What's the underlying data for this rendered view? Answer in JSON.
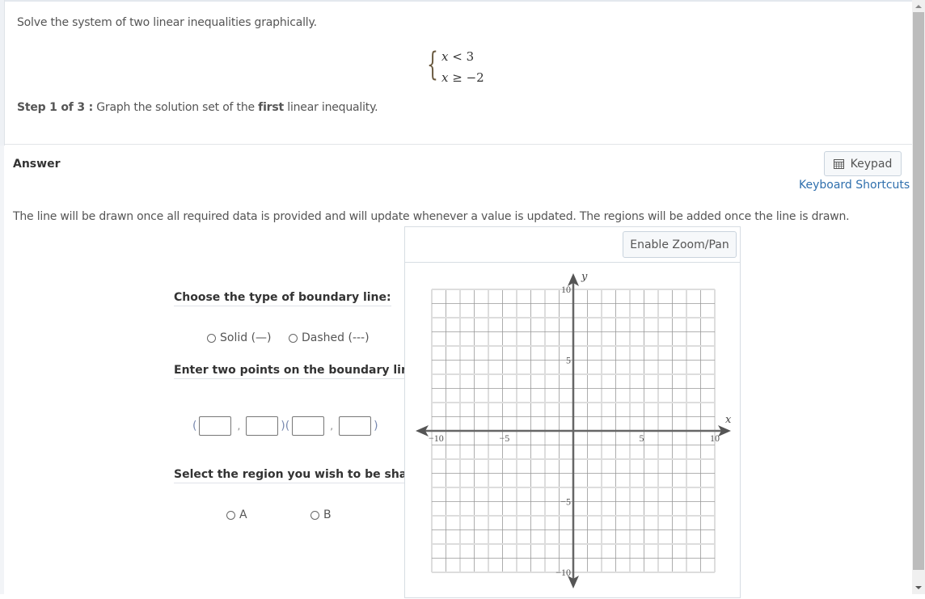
{
  "question": {
    "prompt": "Solve the system of two linear inequalities graphically.",
    "system": [
      {
        "var": "x",
        "op": "<",
        "rhs": "3"
      },
      {
        "var": "x",
        "op": "≥",
        "rhs": "−2"
      }
    ],
    "step_prefix": "Step 1 of 3 :",
    "step_text_before": " Graph the solution set of the ",
    "step_bold": "first",
    "step_text_after": " linear inequality."
  },
  "answer": {
    "label": "Answer",
    "keypad_label": "Keypad",
    "keyboard_shortcuts_label": "Keyboard Shortcuts",
    "info": "The line will be drawn once all required data is provided and will update whenever a value is updated. The regions will be added once the line is drawn.",
    "boundary_label": "Choose the type of boundary line:",
    "boundary_options": [
      {
        "label": "Solid (—)",
        "selected": false
      },
      {
        "label": "Dashed (---)",
        "selected": false
      }
    ],
    "points_label": "Enter two points on the boundary line:",
    "points": {
      "open_paren": "(",
      "comma": ",",
      "close_open": ")(",
      "close_paren": ")",
      "values": [
        "",
        "",
        "",
        ""
      ]
    },
    "region_label": "Select the region you wish to be shaded:",
    "region_options": [
      {
        "label": "A",
        "selected": false
      },
      {
        "label": "B",
        "selected": false
      }
    ]
  },
  "graph": {
    "zoom_button_label": "Enable Zoom/Pan",
    "x_axis_label": "x",
    "y_axis_label": "y",
    "x_range": [
      -10,
      10
    ],
    "y_range": [
      -10,
      10
    ],
    "grid_step": 1,
    "x_tick_labels": [
      {
        "value": -10,
        "label": "−10"
      },
      {
        "value": -5,
        "label": "−5"
      },
      {
        "value": 5,
        "label": "5"
      },
      {
        "value": 10,
        "label": "10"
      }
    ],
    "y_tick_labels": [
      {
        "value": 10,
        "label": "10"
      },
      {
        "value": 5,
        "label": "5"
      },
      {
        "value": -5,
        "label": "−5"
      },
      {
        "value": -10,
        "label": "−10"
      }
    ],
    "axis_color": "#666666",
    "grid_major_color": "#dddddd",
    "grid_minor_color": "#999999"
  }
}
